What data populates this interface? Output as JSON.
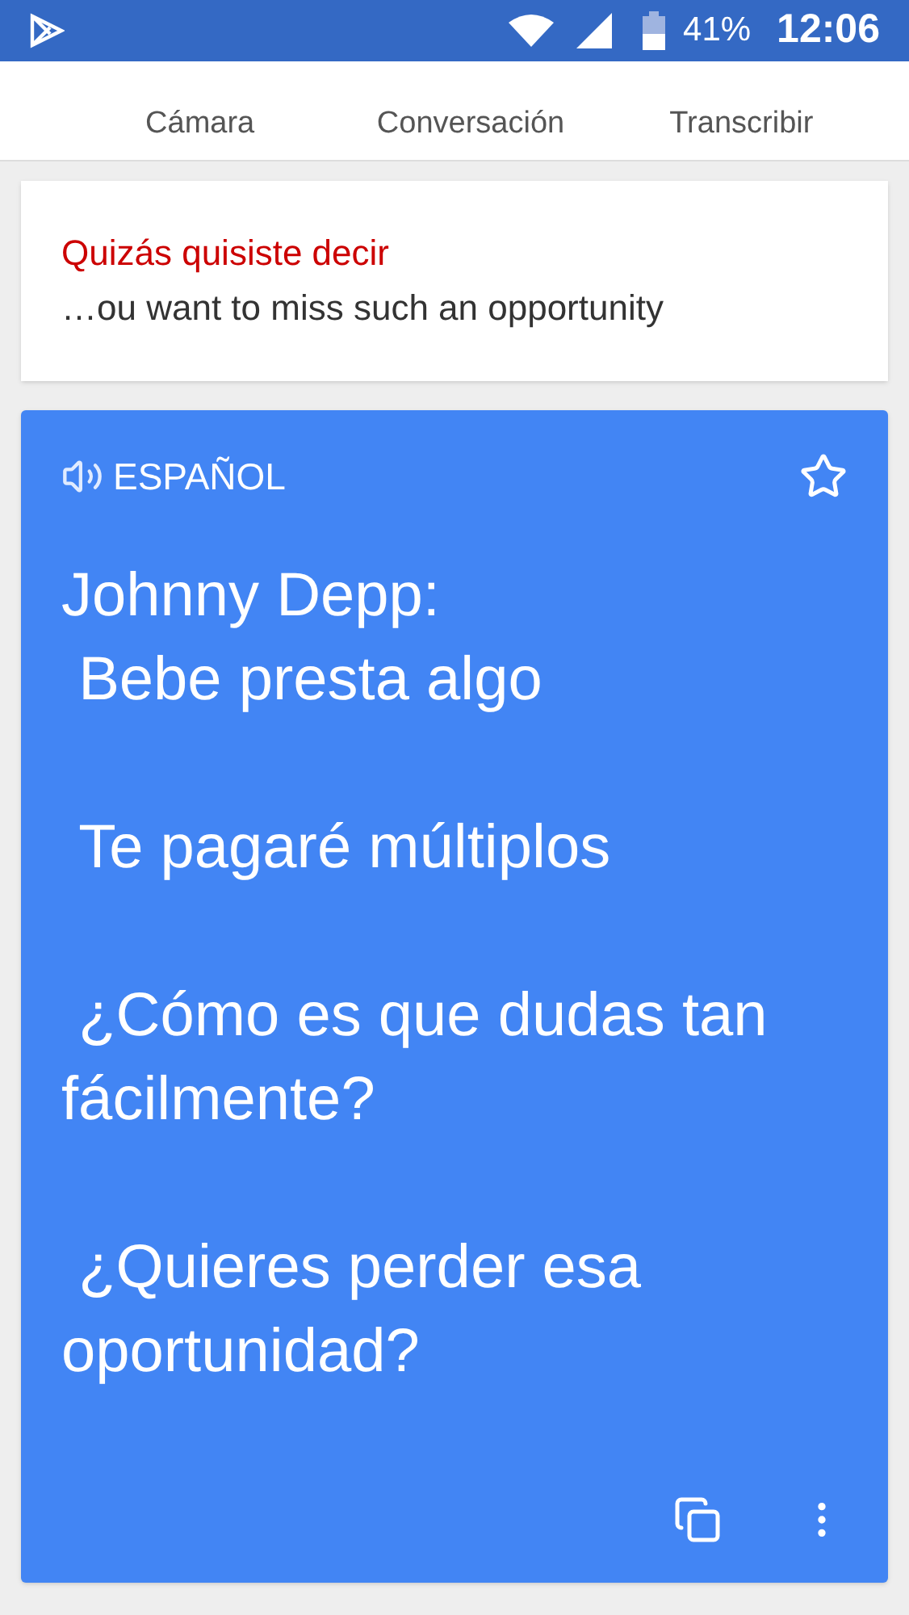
{
  "status_bar": {
    "battery": "41%",
    "time": "12:06"
  },
  "tabs": [
    {
      "label": "Cámara"
    },
    {
      "label": "Conversación"
    },
    {
      "label": "Transcribir"
    }
  ],
  "suggestion": {
    "heading": "Quizás quisiste decir",
    "text": "…ou want to miss such an opportunity"
  },
  "translation": {
    "language": "ESPAÑOL",
    "starred": false,
    "paragraphs": [
      "Johnny Depp:\n Bebe presta algo",
      " Te pagaré múltiplos",
      " ¿Cómo es que dudas tan fácilmente?",
      " ¿Quieres perder esa oportunidad?"
    ]
  }
}
